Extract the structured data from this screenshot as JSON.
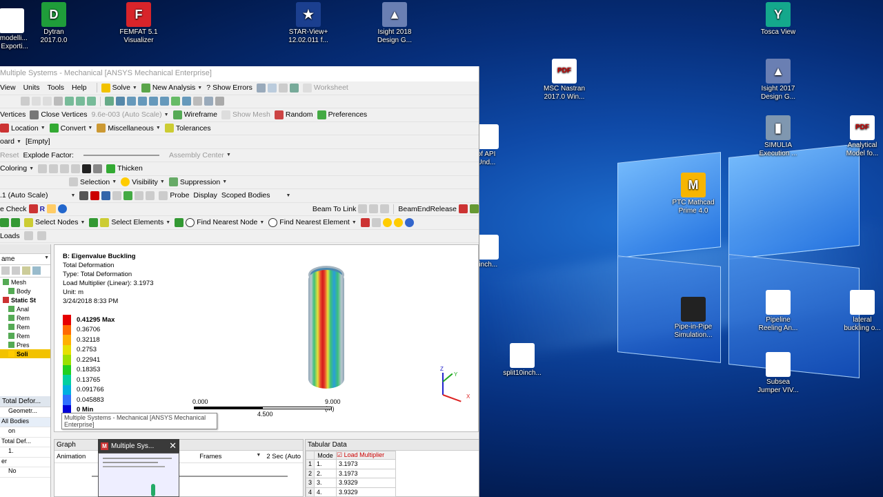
{
  "desktop": {
    "icons": [
      {
        "label": "bmodelli...\nd Exporti...",
        "color": "#ffffff",
        "glyph": ""
      },
      {
        "label": "Dytran\n2017.0.0",
        "color": "#1f9d3a",
        "glyph": "D"
      },
      {
        "label": "FEMFAT 5.1\nVisualizer",
        "color": "#d8242a",
        "glyph": "F"
      },
      {
        "label": "STAR-View+\n12.02.011 f...",
        "color": "#1b3f8f",
        "glyph": "★"
      },
      {
        "label": "Isight 2018\nDesign G...",
        "color": "#6a7fb3",
        "glyph": "▲"
      },
      {
        "label": "Tosca View",
        "color": "#14a88c",
        "glyph": "Y"
      },
      {
        "label": "MSC Nastran\n2017.0 Win...",
        "color": "#ffffff",
        "glyph": "PDF"
      },
      {
        "label": "Isight 2017\nDesign G...",
        "color": "#6a7fb3",
        "glyph": "▲"
      },
      {
        "label": "of API\nUnd...",
        "color": "#ffffff",
        "glyph": ""
      },
      {
        "label": "SIMULIA\nExecution ...",
        "color": "#7f97b0",
        "glyph": "▮"
      },
      {
        "label": "Analytical\nModel fo...",
        "color": "#ffffff",
        "glyph": "PDF"
      },
      {
        "label": "PTC Mathcad\nPrime 4.0",
        "color": "#f7b500",
        "glyph": "M"
      },
      {
        "label": "0inch...",
        "color": "#ffffff",
        "glyph": ""
      },
      {
        "label": "Pipe-in-Pipe\nSimulation...",
        "color": "#222222",
        "glyph": ""
      },
      {
        "label": "Pipeline\nReeling An...",
        "color": "#ffffff",
        "glyph": ""
      },
      {
        "label": "lateral\nbuckling o...",
        "color": "#ffffff",
        "glyph": ""
      },
      {
        "label": "split10inch...",
        "color": "#ffffff",
        "glyph": ""
      },
      {
        "label": "Subsea\nJumper VIV...",
        "color": "#ffffff",
        "glyph": ""
      }
    ]
  },
  "app": {
    "title": "Multiple Systems - Mechanical [ANSYS Mechanical Enterprise]",
    "menu": [
      "View",
      "Units",
      "Tools",
      "Help"
    ],
    "toolbar1": {
      "solve": "Solve",
      "new_analysis": "New Analysis",
      "show_errors": "Show Errors",
      "worksheet": "Worksheet"
    },
    "toolbar3": {
      "vertices": "Vertices",
      "close_vertices": "Close Vertices",
      "scale": "9.6e-003 (Auto Scale)",
      "wireframe": "Wireframe",
      "show_mesh": "Show Mesh",
      "random": "Random",
      "preferences": "Preferences"
    },
    "toolbar4": {
      "location": "Location",
      "convert": "Convert",
      "misc": "Miscellaneous",
      "tolerances": "Tolerances"
    },
    "toolbar5": {
      "board": "oard",
      "empty": "[Empty]"
    },
    "toolbar6": {
      "reset": "Reset",
      "explode": "Explode Factor:",
      "assembly": "Assembly Center"
    },
    "toolbar7": {
      "coloring": "Coloring",
      "thicken": "Thicken"
    },
    "toolbar8": {
      "selection": "Selection",
      "visibility": "Visibility",
      "suppression": "Suppression"
    },
    "toolbar9": {
      "scale": ".1 (Auto Scale)",
      "probe": "Probe",
      "display": "Display",
      "scoped": "Scoped Bodies"
    },
    "toolbar10": {
      "check": "e Check",
      "beam_link": "Beam To Link",
      "beam_end": "BeamEndRelease"
    },
    "toolbar11": {
      "select_nodes": "Select Nodes",
      "select_elements": "Select Elements",
      "nearest_node": "Find Nearest Node",
      "nearest_element": "Find Nearest Element"
    },
    "loads": "Loads"
  },
  "tree": {
    "dropdown": "ame",
    "items": [
      "Mesh",
      "Body",
      "Static St",
      "Anal",
      "Rem",
      "Rem",
      "Rem",
      "Pres",
      "Soli",
      "Total Defor..."
    ]
  },
  "details": {
    "rows": [
      "Geometr...",
      "All Bodies",
      "on",
      "Total Def...",
      "1.",
      "er",
      "No"
    ]
  },
  "viewport": {
    "title": "B: Eigenvalue Buckling",
    "lines": [
      "Total Deformation",
      "Type: Total Deformation",
      "Load Multiplier (Linear): 3.1973",
      "Unit: m",
      "3/24/2018 8:33 PM"
    ],
    "legend": [
      {
        "label": "0.41295 Max",
        "color": "#e60000"
      },
      {
        "label": "0.36706",
        "color": "#ff6a00"
      },
      {
        "label": "0.32118",
        "color": "#ffb000"
      },
      {
        "label": "0.2753",
        "color": "#e6e000"
      },
      {
        "label": "0.22941",
        "color": "#9be000"
      },
      {
        "label": "0.18353",
        "color": "#20d020"
      },
      {
        "label": "0.13765",
        "color": "#00d0a0"
      },
      {
        "label": "0.091766",
        "color": "#00b0e0"
      },
      {
        "label": "0.045883",
        "color": "#3070ff"
      },
      {
        "label": "0 Min",
        "color": "#0000d8"
      }
    ],
    "scale_left": "0.000",
    "scale_mid": "4.500",
    "scale_right": "9.000 (m)",
    "axis_z": "Z",
    "axis_y": "Y",
    "axis_x": "X",
    "tooltip": "Multiple Systems - Mechanical [ANSYS Mechanical Enterprise]"
  },
  "graph": {
    "title": "Graph",
    "animation": "Animation",
    "frames": "Frames",
    "sec": "2 Sec (Auto"
  },
  "tabular": {
    "title": "Tabular Data",
    "col_mode": "Mode",
    "col_load": "Load Multiplier",
    "rows": [
      {
        "n": "1",
        "mode": "1.",
        "val": "3.1973"
      },
      {
        "n": "2",
        "mode": "2.",
        "val": "3.1973"
      },
      {
        "n": "3",
        "mode": "3.",
        "val": "3.9329"
      },
      {
        "n": "4",
        "mode": "4.",
        "val": "3.9329"
      }
    ]
  },
  "taskbar_thumb": {
    "label": "Multiple Sys..."
  }
}
